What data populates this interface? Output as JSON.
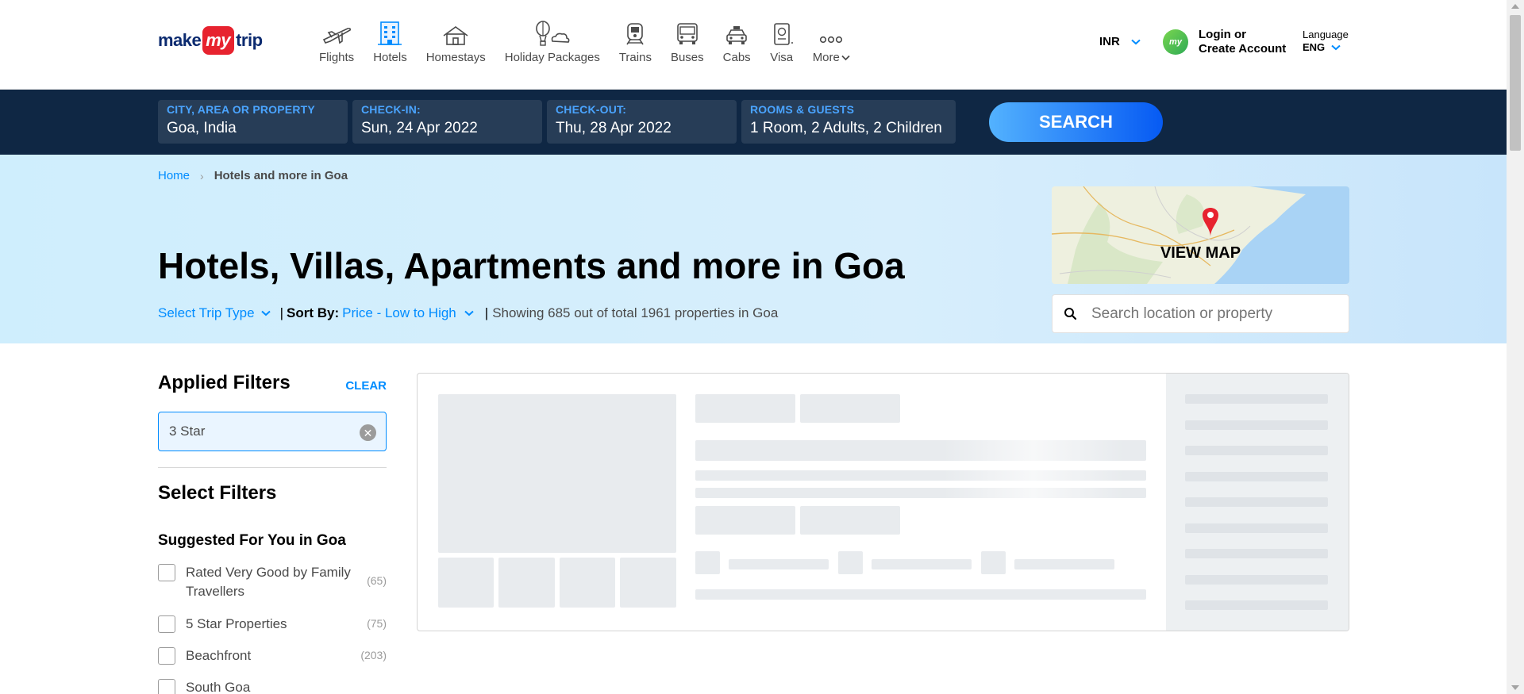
{
  "logo": {
    "make": "make",
    "my": "my",
    "trip": "trip"
  },
  "nav": [
    {
      "label": "Flights",
      "icon": "plane-icon"
    },
    {
      "label": "Hotels",
      "icon": "hotel-icon"
    },
    {
      "label": "Homestays",
      "icon": "homestay-icon"
    },
    {
      "label": "Holiday Packages",
      "icon": "holiday-icon"
    },
    {
      "label": "Trains",
      "icon": "train-icon"
    },
    {
      "label": "Buses",
      "icon": "bus-icon"
    },
    {
      "label": "Cabs",
      "icon": "cab-icon"
    },
    {
      "label": "Visa",
      "icon": "visa-icon"
    },
    {
      "label": "More",
      "icon": "more-icon"
    }
  ],
  "currency": "INR",
  "login": {
    "avatar": "my",
    "line1": "Login or",
    "line2": "Create Account"
  },
  "language": {
    "label": "Language",
    "value": "ENG"
  },
  "search": {
    "city_label": "CITY, AREA OR PROPERTY",
    "city_value": "Goa, India",
    "checkin_label": "CHECK-IN:",
    "checkin_value": "Sun, 24 Apr 2022",
    "checkout_label": "CHECK-OUT:",
    "checkout_value": "Thu, 28 Apr 2022",
    "rooms_label": "ROOMS & GUESTS",
    "rooms_value": "1 Room, 2 Adults, 2 Children",
    "button": "SEARCH"
  },
  "breadcrumb": {
    "home": "Home",
    "separator": "›",
    "current": "Hotels and more in Goa"
  },
  "title": "Hotels, Villas, Apartments and more in Goa",
  "subrow": {
    "trip_type": "Select Trip Type",
    "sep": "|",
    "sort_label": "Sort By:",
    "sort_value": "Price - Low to High",
    "showing": "Showing 685 out of total 1961 properties in Goa"
  },
  "map": {
    "label": "VIEW MAP"
  },
  "location_search": {
    "placeholder": "Search location or property"
  },
  "sidebar": {
    "applied_title": "Applied Filters",
    "clear": "CLEAR",
    "applied_chip": "3 Star",
    "select_title": "Select Filters",
    "suggested_title": "Suggested For You in Goa",
    "filters": [
      {
        "label": "Rated Very Good by Family Travellers",
        "count": "(65)"
      },
      {
        "label": "5 Star Properties",
        "count": "(75)"
      },
      {
        "label": "Beachfront",
        "count": "(203)"
      },
      {
        "label": "South Goa",
        "count": ""
      }
    ]
  },
  "colors": {
    "brand_blue": "#008cff",
    "nav_dark": "#0f2744",
    "logo_red": "#e7232f"
  }
}
